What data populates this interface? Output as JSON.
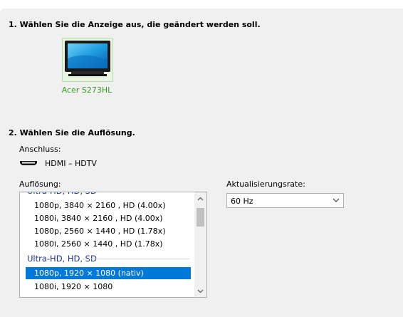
{
  "step1": {
    "heading": "1. Wählen Sie die Anzeige aus, die geändert werden soll."
  },
  "display": {
    "name": "Acer S273HL",
    "icon": "monitor-icon"
  },
  "step2": {
    "heading": "2. Wählen Sie die Auflösung."
  },
  "connection": {
    "label": "Anschluss:",
    "icon": "hdmi-icon",
    "value": "HDMI – HDTV"
  },
  "resolution": {
    "label": "Auflösung:",
    "items": [
      "1080p, 3840 × 2160 , HD (4.00x)",
      "1080i, 3840 × 2160 , HD (4.00x)",
      "1080p, 2560 × 1440 , HD (1.78x)",
      "1080i, 2560 × 1440 , HD (1.78x)"
    ],
    "group_label": "Ultra-HD, HD, SD",
    "selected": "1080p, 1920 × 1080 (nativ)",
    "after_selected": "1080i, 1920 × 1080"
  },
  "refresh": {
    "label": "Aktualisierungsrate:",
    "value": "60 Hz"
  },
  "colors": {
    "selection": "#0078d7",
    "display_name": "#3a9b24",
    "group": "#1e3287"
  }
}
